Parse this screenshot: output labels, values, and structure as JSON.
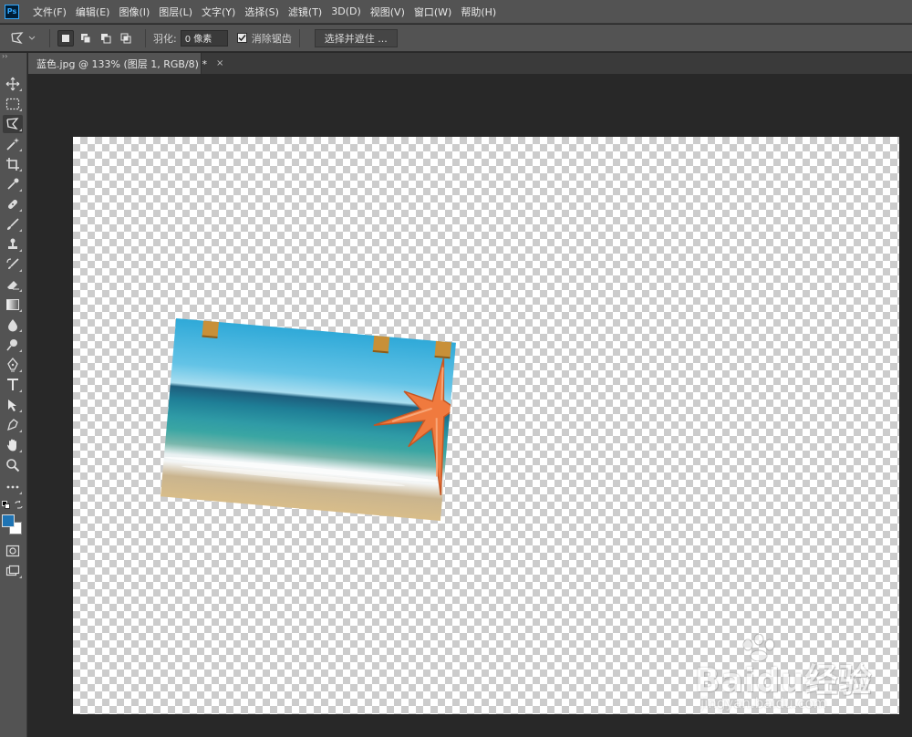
{
  "app": {
    "logo_text": "Ps"
  },
  "menu": [
    "文件(F)",
    "编辑(E)",
    "图像(I)",
    "图层(L)",
    "文字(Y)",
    "选择(S)",
    "滤镜(T)",
    "3D(D)",
    "视图(V)",
    "窗口(W)",
    "帮助(H)"
  ],
  "options_bar": {
    "feather_label": "羽化:",
    "feather_value": "0 像素",
    "antialias_label": "消除锯齿",
    "antialias_checked": true,
    "select_mask_label": "选择并遮住 ..."
  },
  "document": {
    "tab_title": "蓝色.jpg @ 133% (图层 1, RGB/8) *",
    "close_glyph": "×"
  },
  "toolbar": {
    "active_tool": "polygonal-lasso",
    "foreground_color": "#1f74b4",
    "background_color": "#ffffff"
  },
  "watermark": {
    "brand": "Baidu经验",
    "url": "jingyan.baidu.com"
  }
}
